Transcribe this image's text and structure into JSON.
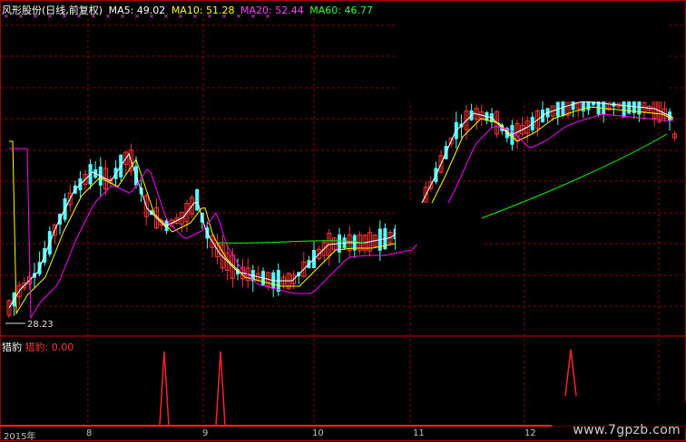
{
  "header": {
    "stock_name": "风形股份(日线,前复权)",
    "ma5": "MA5: 49.02",
    "ma10": "MA10: 51.28",
    "ma20": "MA20: 52.44",
    "ma60": "MA60: 46.77"
  },
  "indicator": {
    "name": "猎豹",
    "value_label": "猎豹: 0.00"
  },
  "low_price_label": "28.23",
  "x_axis": {
    "year_label": "2015年",
    "months": [
      "8",
      "9",
      "10",
      "11",
      "12"
    ]
  },
  "watermark": "www.7gpzb.com",
  "colors": {
    "background": "#000000",
    "grid": "#8b0000",
    "up_candle": "#ff3333",
    "down_candle": "#54ffff",
    "ma5": "#ffffff",
    "ma10": "#ffff00",
    "ma20": "#ff00ff",
    "ma60": "#00ff00"
  }
}
